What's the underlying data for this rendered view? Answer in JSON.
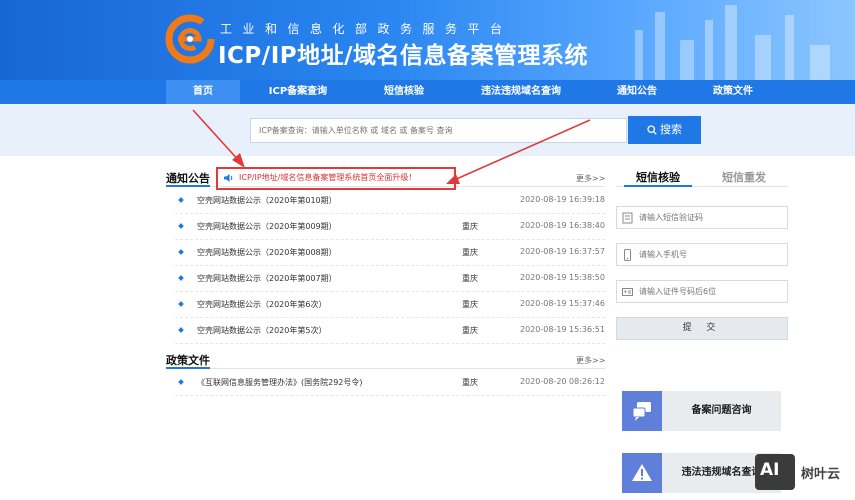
{
  "header": {
    "subtitle": "工业和信息化部政务服务平台",
    "title": "ICP/IP地址/域名信息备案管理系统"
  },
  "nav": {
    "items": [
      "首页",
      "ICP备案查询",
      "短信核验",
      "违法违规域名查询",
      "通知公告",
      "政策文件"
    ],
    "active": "首页"
  },
  "search": {
    "placeholder": "ICP备案查询：请输入单位名称 或 域名 或 备案号 查询",
    "button_label": "搜索"
  },
  "notices": {
    "title": "通知公告",
    "more": "更多>>",
    "highlight": "ICP/IP地址/域名信息备案管理系统首页全面升级！",
    "rows": [
      {
        "title": "空壳网站数据公示（2020年第010期）",
        "region": "",
        "date": "2020-08-19 16:39:18"
      },
      {
        "title": "空壳网站数据公示（2020年第009期）",
        "region": "重庆",
        "date": "2020-08-19 16:38:40"
      },
      {
        "title": "空壳网站数据公示（2020年第008期）",
        "region": "重庆",
        "date": "2020-08-19 16:37:57"
      },
      {
        "title": "空壳网站数据公示（2020年第007期）",
        "region": "重庆",
        "date": "2020-08-19 15:38:50"
      },
      {
        "title": "空壳网站数据公示（2020年第6次）",
        "region": "重庆",
        "date": "2020-08-19 15:37:46"
      },
      {
        "title": "空壳网站数据公示（2020年第5次）",
        "region": "重庆",
        "date": "2020-08-19 15:36:51"
      }
    ]
  },
  "policy": {
    "title": "政策文件",
    "more": "更多>>",
    "rows": [
      {
        "title": "《互联网信息服务管理办法》(国务院292号令)",
        "region": "重庆",
        "date": "2020-08-20 08:26:12"
      }
    ]
  },
  "sms": {
    "tabs": [
      "短信核验",
      "短信重发"
    ],
    "active_tab": "短信核验",
    "code_placeholder": "请输入短信验证码",
    "phone_placeholder": "请输入手机号",
    "id_placeholder": "请输入证件号码后6位",
    "submit_label": "提 交"
  },
  "cards": {
    "consult": "备案问题咨询",
    "illegal": "违法违规域名查询"
  },
  "watermark": {
    "badge": "AI",
    "text": "树叶云"
  },
  "colors": {
    "primary": "#1f78e6",
    "highlight_red": "#e23a3a",
    "card_icon": "#5f7fdb"
  }
}
